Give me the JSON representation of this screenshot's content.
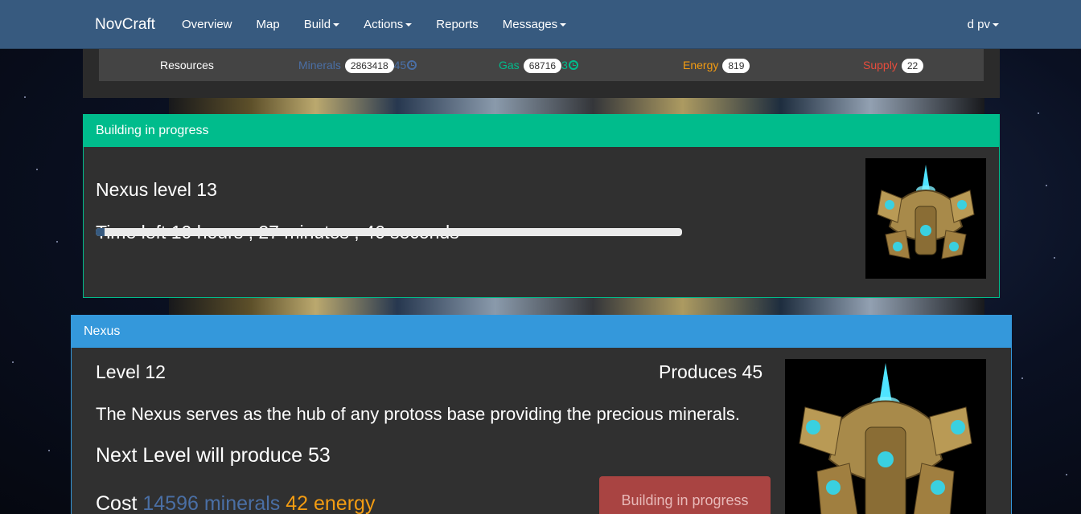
{
  "navbar": {
    "brand": "NovCraft",
    "items": [
      {
        "label": "Overview",
        "dropdown": false
      },
      {
        "label": "Map",
        "dropdown": false
      },
      {
        "label": "Build",
        "dropdown": true
      },
      {
        "label": "Actions",
        "dropdown": true
      },
      {
        "label": "Reports",
        "dropdown": false
      },
      {
        "label": "Messages",
        "dropdown": true
      }
    ],
    "user": "d pv"
  },
  "resources": {
    "title": "Resources",
    "minerals": {
      "label": "Minerals",
      "value": "2863418",
      "rate": "45"
    },
    "gas": {
      "label": "Gas",
      "value": "68716",
      "rate": "3"
    },
    "energy": {
      "label": "Energy",
      "value": "819"
    },
    "supply": {
      "label": "Supply",
      "value": "22"
    }
  },
  "construction": {
    "heading": "Building in progress",
    "name": "Nexus level 13",
    "time_left": "Time left 10 hours , 27 minutes , 46 seconds",
    "progress_fraction": 0.015
  },
  "building": {
    "heading": "Nexus",
    "level": "Level 12",
    "produces": "Produces 45",
    "description": "The Nexus serves as the hub of any protoss base providing the precious minerals.",
    "next_level": "Next Level will produce 53",
    "cost_label": "Cost",
    "cost_minerals": "14596 minerals",
    "cost_energy": "42 energy",
    "action_button": "Building in progress"
  },
  "colors": {
    "navbar": "#375a7f",
    "success": "#00bc8c",
    "primary": "#3498db",
    "danger": "#a94442",
    "minerals": "#4a6fa5",
    "energy": "#f39c12",
    "supply": "#e74c3c"
  },
  "icons": [
    "clock-icon",
    "caret-down-icon",
    "nexus-building-image"
  ]
}
